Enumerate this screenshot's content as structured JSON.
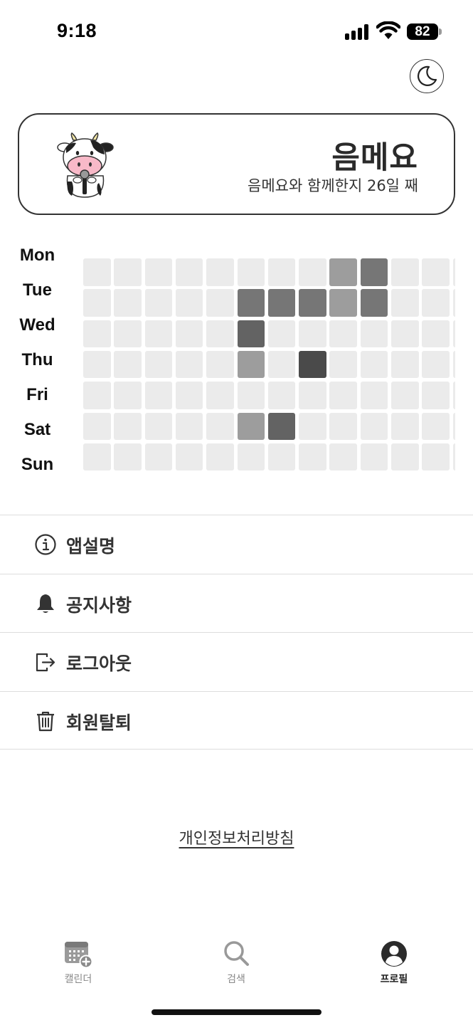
{
  "status_bar": {
    "time": "9:18",
    "battery": "82",
    "icons": [
      "signal-icon",
      "wifi-icon",
      "battery-icon"
    ]
  },
  "theme_toggle": {
    "icon": "moon-icon"
  },
  "profile": {
    "name": "음메요",
    "subtitle": "음메요와 함께한지 26일 째",
    "avatar_icon": "cow-avatar-icon"
  },
  "heatmap": {
    "days": [
      "Mon",
      "Tue",
      "Wed",
      "Thu",
      "Fri",
      "Sat",
      "Sun"
    ],
    "levels": [
      [
        0,
        0,
        0,
        0,
        0,
        0,
        0,
        0,
        2,
        3,
        0,
        0,
        0
      ],
      [
        0,
        0,
        0,
        0,
        0,
        3,
        3,
        3,
        2,
        3,
        0,
        0,
        0
      ],
      [
        0,
        0,
        0,
        0,
        0,
        4,
        0,
        0,
        0,
        0,
        0,
        0,
        0
      ],
      [
        0,
        0,
        0,
        0,
        0,
        2,
        0,
        5,
        0,
        0,
        0,
        0,
        0
      ],
      [
        0,
        0,
        0,
        0,
        0,
        0,
        0,
        0,
        0,
        0,
        0,
        0,
        0
      ],
      [
        0,
        0,
        0,
        0,
        0,
        2,
        4,
        0,
        0,
        0,
        0,
        0,
        0
      ],
      [
        0,
        0,
        0,
        0,
        0,
        0,
        0,
        0,
        0,
        0,
        0,
        0,
        0
      ]
    ],
    "level_colors": [
      "#ebebeb",
      "#c4c4c4",
      "#9d9d9d",
      "#767676",
      "#636363",
      "#4a4a4a"
    ]
  },
  "menu": {
    "items": [
      {
        "label": "앱설명",
        "icon": "info-icon"
      },
      {
        "label": "공지사항",
        "icon": "bell-icon"
      },
      {
        "label": "로그아웃",
        "icon": "logout-icon"
      },
      {
        "label": "회원탈퇴",
        "icon": "trash-icon"
      }
    ]
  },
  "privacy_link": "개인정보처리방침",
  "tabs": [
    {
      "label": "캘린더",
      "icon": "calendar-add-icon",
      "active": false
    },
    {
      "label": "검색",
      "icon": "search-icon",
      "active": false
    },
    {
      "label": "프로필",
      "icon": "profile-icon",
      "active": true
    }
  ]
}
